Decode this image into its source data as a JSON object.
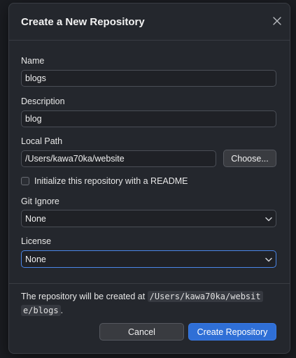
{
  "dialog": {
    "title": "Create a New Repository",
    "close_icon": "close-icon"
  },
  "form": {
    "name_label": "Name",
    "name_value": "blogs",
    "description_label": "Description",
    "description_value": "blog",
    "local_path_label": "Local Path",
    "local_path_value": "/Users/kawa70ka/website",
    "choose_button": "Choose...",
    "readme_checkbox_label": "Initialize this repository with a README",
    "readme_checked": false,
    "gitignore_label": "Git Ignore",
    "gitignore_value": "None",
    "license_label": "License",
    "license_value": "None"
  },
  "footer": {
    "info_prefix": "The repository will be created at",
    "info_path_line1": "/Users/kawa70ka/websit",
    "info_path_line2": "e/blogs",
    "info_suffix": ".",
    "cancel_button": "Cancel",
    "create_button": "Create Repository"
  },
  "colors": {
    "dialog_bg": "#24272d",
    "accent": "#2f6fd6",
    "focus_border": "#4a86e8"
  }
}
